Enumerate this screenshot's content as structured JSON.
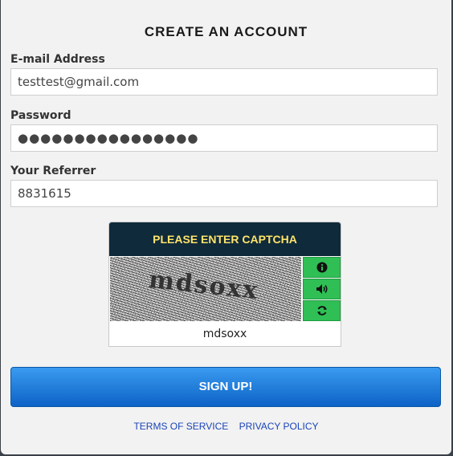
{
  "form": {
    "title": "CREATE AN ACCOUNT",
    "email_label": "E-mail Address",
    "email_value": "testtest@gmail.com",
    "password_label": "Password",
    "password_value": "●●●●●●●●●●●●●●●●",
    "referrer_label": "Your Referrer",
    "referrer_value": "8831615"
  },
  "captcha": {
    "heading": "PLEASE ENTER CAPTCHA",
    "image_text": "mdsoxx",
    "input_value": "mdsoxx",
    "buttons": [
      "info-icon",
      "speaker-icon",
      "refresh-icon"
    ],
    "button_color": "#2fbf55",
    "header_bg": "#0f2a3a",
    "header_color": "#ffe36a"
  },
  "signup_label": "SIGN UP!",
  "links": {
    "terms": "TERMS OF SERVICE",
    "privacy": "PRIVACY POLICY"
  }
}
